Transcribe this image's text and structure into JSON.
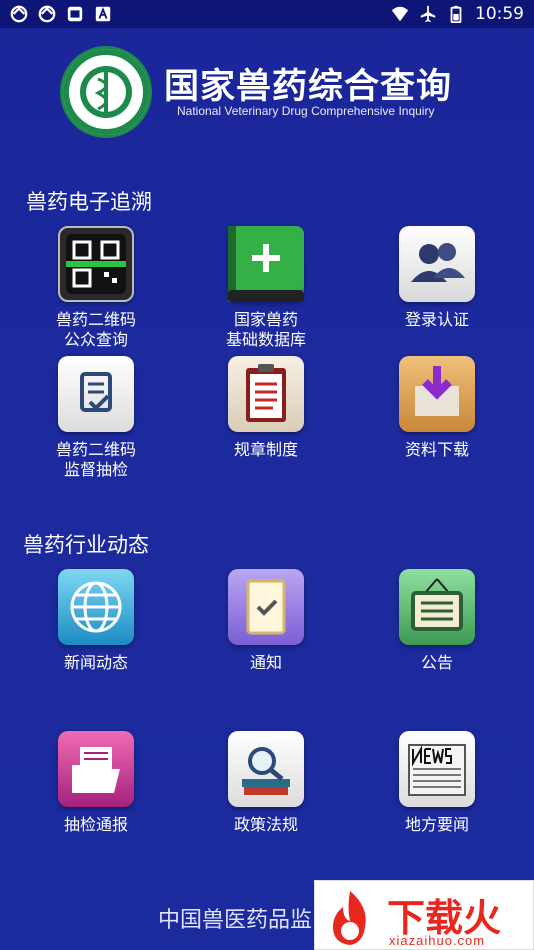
{
  "status_bar": {
    "time": "10:59"
  },
  "header": {
    "title": "国家兽药综合查询",
    "subtitle": "National Veterinary Drug Comprehensive Inquiry"
  },
  "sections": [
    {
      "title": "兽药电子追溯",
      "items": [
        {
          "label": "兽药二维码\n公众查询",
          "icon": "qr-scan-icon"
        },
        {
          "label": "国家兽药\n基础数据库",
          "icon": "database-book-icon"
        },
        {
          "label": "登录认证",
          "icon": "users-icon"
        },
        {
          "label": "兽药二维码\n监督抽检",
          "icon": "inspection-doc-icon"
        },
        {
          "label": "规章制度",
          "icon": "clipboard-list-icon"
        },
        {
          "label": "资料下载",
          "icon": "download-tray-icon"
        }
      ]
    },
    {
      "title": "兽药行业动态",
      "items": [
        {
          "label": "新闻动态",
          "icon": "globe-icon"
        },
        {
          "label": "通知",
          "icon": "notice-check-icon"
        },
        {
          "label": "公告",
          "icon": "bulletin-board-icon"
        },
        {
          "label": "抽检通报",
          "icon": "folder-icon"
        },
        {
          "label": "政策法规",
          "icon": "search-books-icon"
        },
        {
          "label": "地方要闻",
          "icon": "newspaper-icon"
        }
      ]
    }
  ],
  "footer": {
    "text": "中国兽医药品监"
  },
  "watermark": {
    "text": "下载火",
    "url": "xiazaihuo.com"
  },
  "colors": {
    "background": "#1b2a9c",
    "status_bar": "#0d1577",
    "watermark_red": "#e8281e"
  }
}
